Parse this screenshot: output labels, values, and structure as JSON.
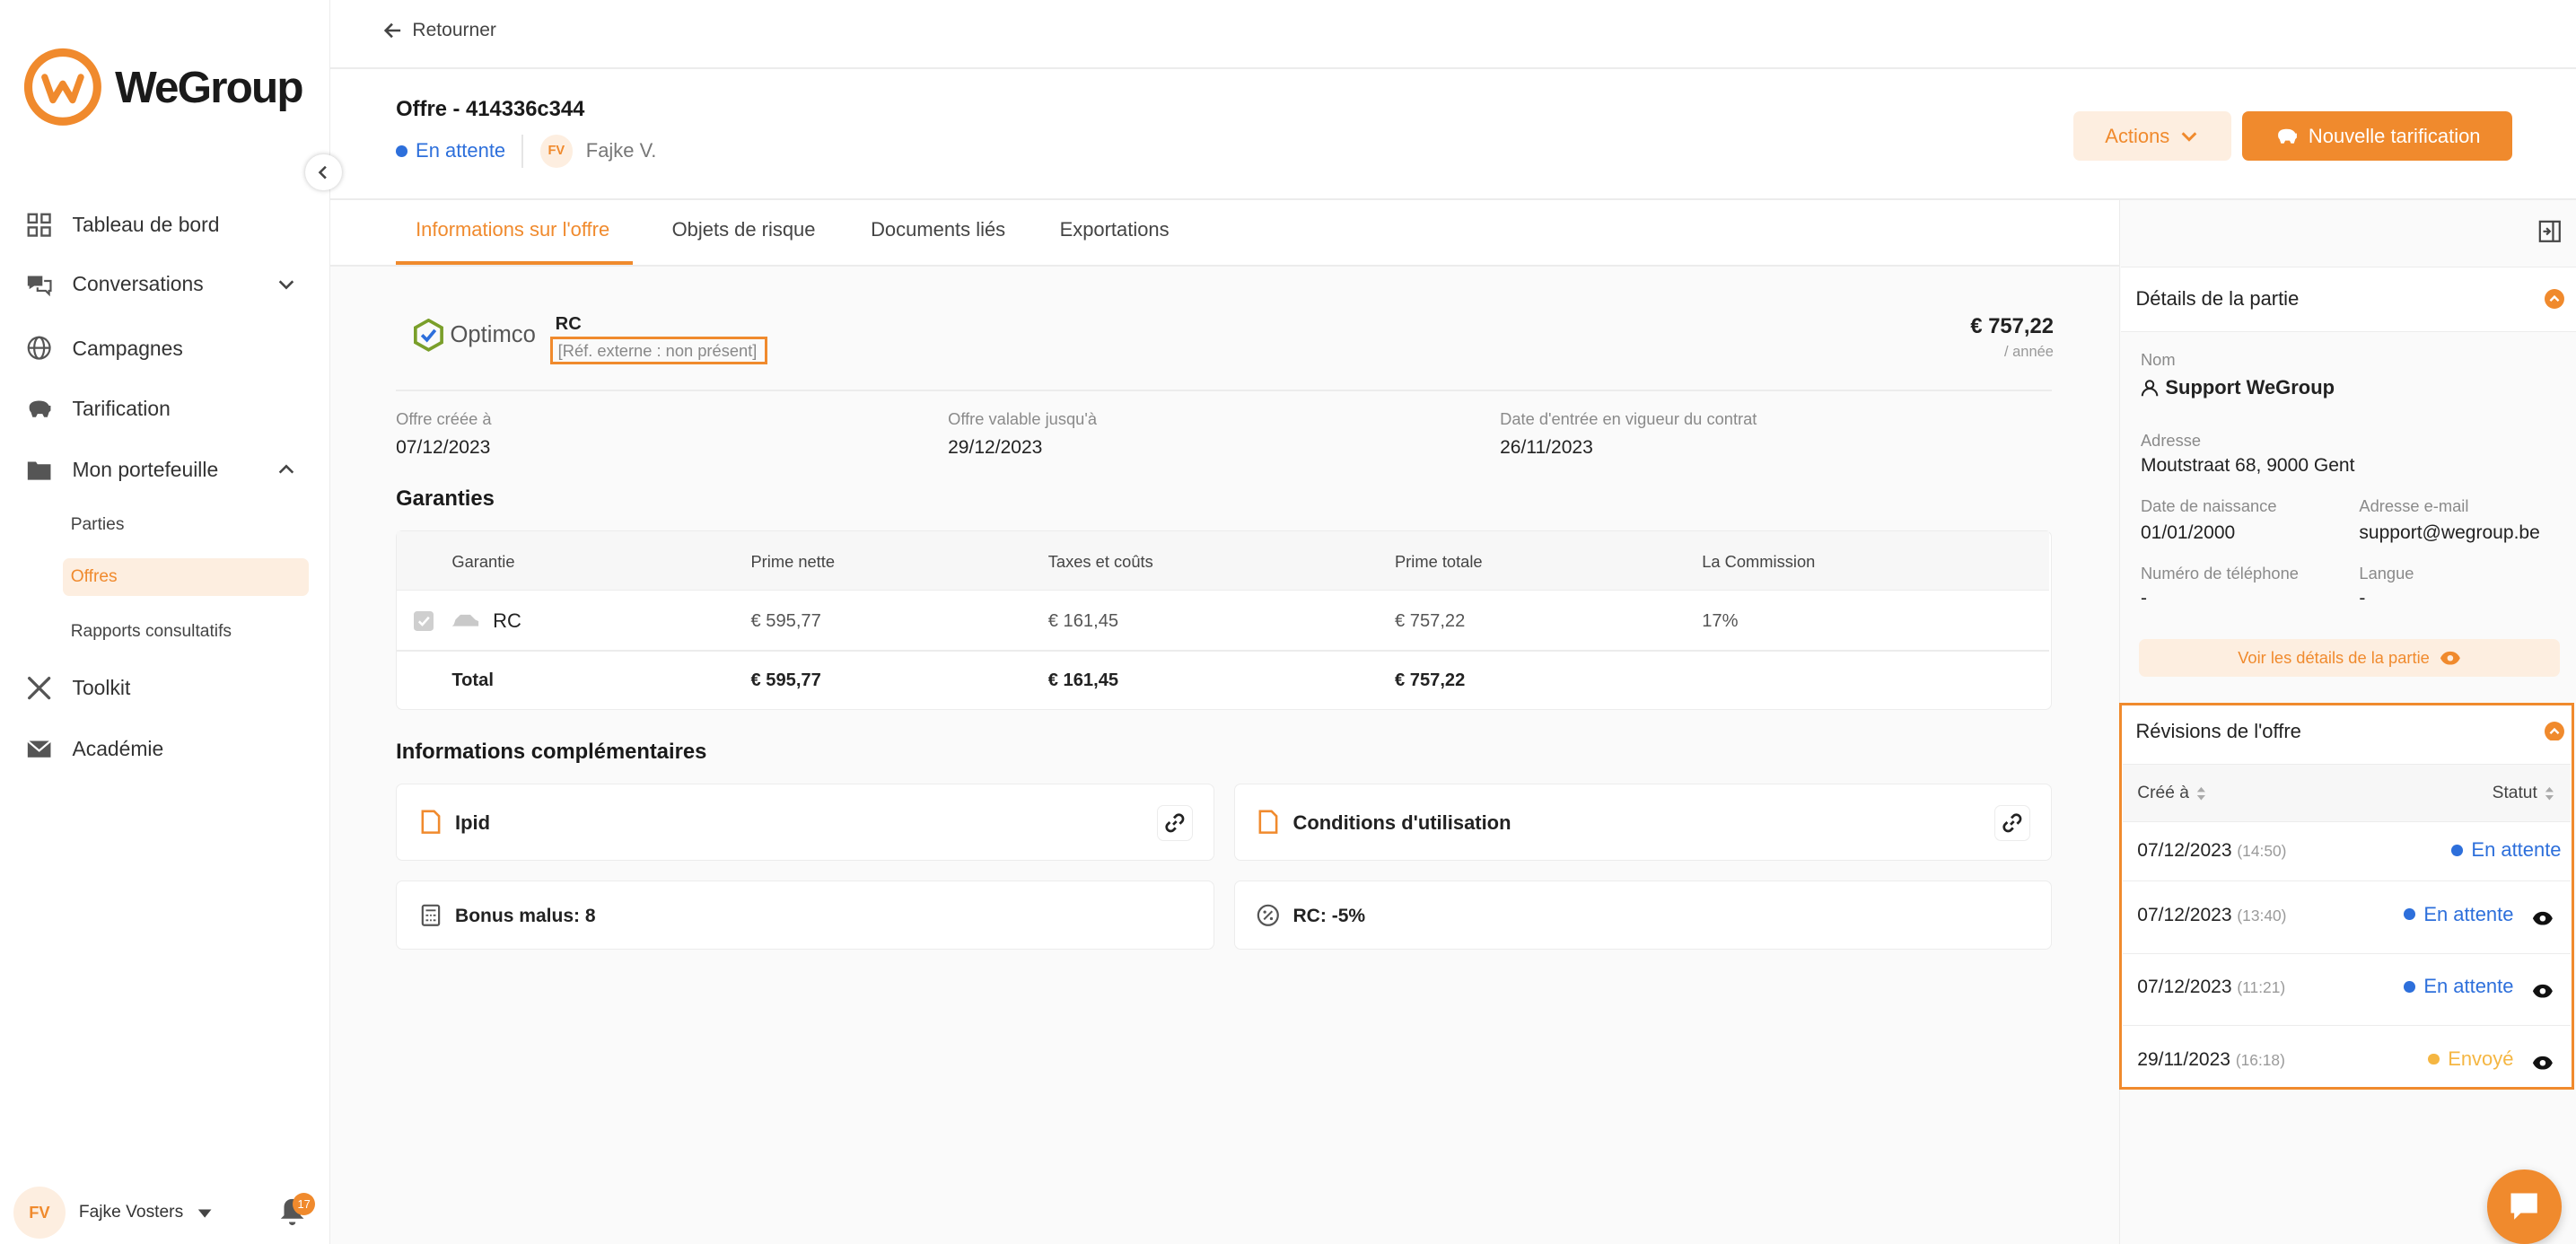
{
  "brand": {
    "name": "WeGroup",
    "accent": "#f08a2d",
    "blue": "#2d6fdb"
  },
  "sidebar": {
    "items": [
      {
        "label": "Tableau de bord",
        "icon": "dashboard-grid-icon"
      },
      {
        "label": "Conversations",
        "icon": "chat-icon"
      },
      {
        "label": "Campagnes",
        "icon": "globe-icon"
      },
      {
        "label": "Tarification",
        "icon": "piggy-bank-icon"
      },
      {
        "label": "Mon portefeuille",
        "icon": "folder-icon"
      },
      {
        "label": "Toolkit",
        "icon": "tools-icon"
      },
      {
        "label": "Académie",
        "icon": "envelope-icon"
      }
    ],
    "portfolio_sub": [
      {
        "label": "Parties"
      },
      {
        "label": "Offres"
      },
      {
        "label": "Rapports consultatifs"
      }
    ],
    "user": {
      "initials": "FV",
      "name": "Fajke Vosters",
      "notifications": "17"
    }
  },
  "header": {
    "back_label": "Retourner",
    "title": "Offre - 414336c344",
    "status": "En attente",
    "owner_initials": "FV",
    "owner_name": "Fajke V.",
    "actions_label": "Actions",
    "new_label": "Nouvelle tarification"
  },
  "tabs": [
    {
      "label": "Informations sur l'offre"
    },
    {
      "label": "Objets de risque"
    },
    {
      "label": "Documents liés"
    },
    {
      "label": "Exportations"
    }
  ],
  "offer": {
    "insurer": "Optimco",
    "product": "RC",
    "external_ref": "[Réf. externe : non présent]",
    "price": "€ 757,22",
    "period": "/ année",
    "dates": [
      {
        "label": "Offre créée à",
        "value": "07/12/2023"
      },
      {
        "label": "Offre valable jusqu'à",
        "value": "29/12/2023"
      },
      {
        "label": "Date d'entrée en vigueur du contrat",
        "value": "26/11/2023"
      }
    ]
  },
  "guarantees": {
    "title": "Garanties",
    "columns": [
      "Garantie",
      "Prime nette",
      "Taxes et coûts",
      "Prime totale",
      "La Commission"
    ],
    "row": {
      "name": "RC",
      "net": "€ 595,77",
      "tax": "€ 161,45",
      "total": "€ 757,22",
      "commission": "17%"
    },
    "total": {
      "label": "Total",
      "net": "€ 595,77",
      "tax": "€ 161,45",
      "total": "€ 757,22"
    }
  },
  "extra": {
    "title": "Informations complémentaires",
    "doc1": "Ipid",
    "doc2": "Conditions d'utilisation",
    "info1": "Bonus malus: 8",
    "info2": "RC: -5%"
  },
  "party": {
    "title": "Détails de la partie",
    "name_label": "Nom",
    "name": "Support WeGroup",
    "address_label": "Adresse",
    "address": "Moutstraat 68, 9000 Gent",
    "birth_label": "Date de naissance",
    "birth": "01/01/2000",
    "email_label": "Adresse e-mail",
    "email": "support@wegroup.be",
    "phone_label": "Numéro de téléphone",
    "phone": "-",
    "lang_label": "Langue",
    "lang": "-",
    "details_link": "Voir les détails de la partie"
  },
  "revisions": {
    "title": "Révisions de l'offre",
    "col_created": "Créé à",
    "col_status": "Statut",
    "rows": [
      {
        "date": "07/12/2023",
        "time": "(14:50)",
        "status": "En attente"
      },
      {
        "date": "07/12/2023",
        "time": "(13:40)",
        "status": "En attente"
      },
      {
        "date": "07/12/2023",
        "time": "(11:21)",
        "status": "En attente"
      },
      {
        "date": "29/11/2023",
        "time": "(16:18)",
        "status": "Envoyé"
      }
    ]
  }
}
